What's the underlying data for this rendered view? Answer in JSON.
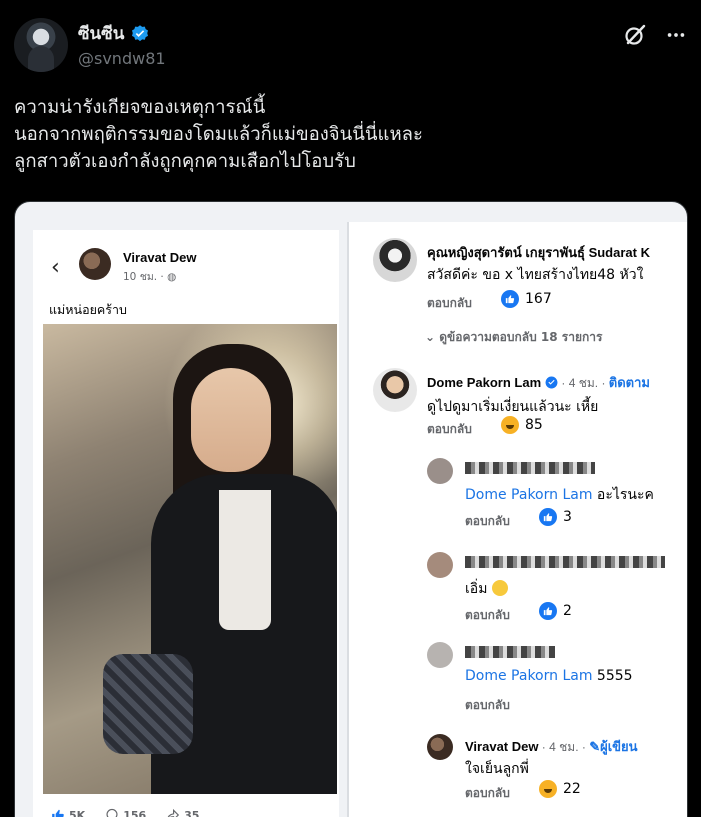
{
  "tweet": {
    "display_name": "ซีนซีน",
    "handle": "@svndw81",
    "lines": [
      "ความน่ารังเกียจของเหตุการณ์นี้",
      "นอกจากพฤติกรรมของโดมแล้วก็แม่ของจินนี่นี่แหละ",
      "ลูกสาวตัวเองกำลังถูกคุกคามเสือกไปโอบรับ"
    ]
  },
  "post": {
    "author": "Viravat Dew",
    "time": "10 ชม. · ",
    "caption": "แม่หน่อยคร้าบ",
    "likes": "5K",
    "comments": "156",
    "shares": "35"
  },
  "comments": {
    "c1": {
      "name": "คุณหญิงสุดารัตน์ เกยุราพันธุ์ Sudarat K",
      "text": "สวัสดีค่ะ ขอ x ไทยสร้างไทย48 หัวใ",
      "reply": "ตอบกลับ",
      "count": "167"
    },
    "view_replies": "ดูข้อความตอบกลับ 18 รายการ",
    "c2": {
      "name": "Dome Pakorn Lam",
      "meta": " · 4 ชม. · ",
      "follow": "ติดตาม",
      "text": "ดูไปดูมาเริ่มเงี่ยนแล้วนะ เหี้ย",
      "reply": "ตอบกลับ",
      "count": "85"
    },
    "r1": {
      "mention": "Dome Pakorn Lam",
      "text": " อะไรนะค",
      "reply": "ตอบกลับ",
      "count": "3"
    },
    "r2": {
      "text": "เอิ่ม ",
      "reply": "ตอบกลับ",
      "count": "2"
    },
    "r3": {
      "mention": "Dome Pakorn Lam",
      "text": " 5555",
      "reply": "ตอบกลับ"
    },
    "r4": {
      "name": "Viravat Dew",
      "meta": " · 4 ชม. · ",
      "author_tag": "ผู้เขียน",
      "text": "ใจเย็นลูกพี่",
      "reply": "ตอบกลับ",
      "count": "22"
    }
  },
  "colors": {
    "verified": "#1d9bf0",
    "fb_blue": "#1877f2",
    "haha": "#f7b125"
  }
}
